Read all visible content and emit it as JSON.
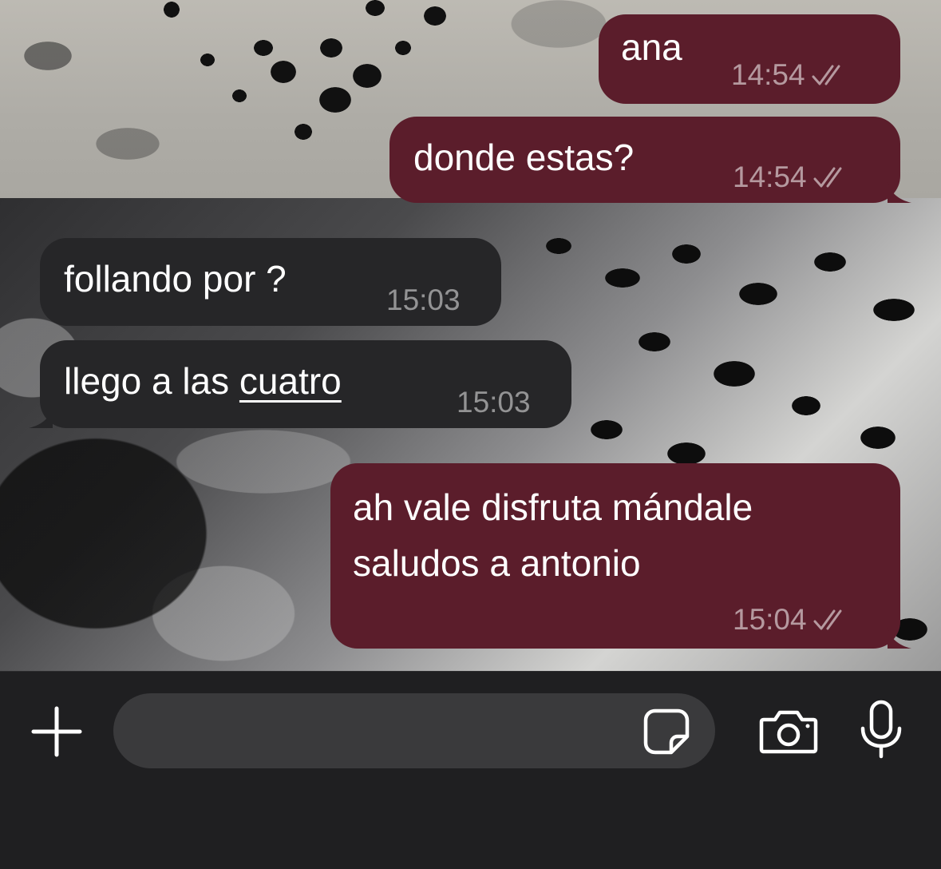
{
  "chat": {
    "messages": [
      {
        "direction": "outgoing",
        "text": "ana",
        "time": "14:54",
        "status": "read"
      },
      {
        "direction": "outgoing",
        "text": "donde estas?",
        "time": "14:54",
        "status": "read"
      },
      {
        "direction": "incoming",
        "text": "follando por ?",
        "time": "15:03"
      },
      {
        "direction": "incoming",
        "text_before_link": "llego a las ",
        "link_text": "cuatro",
        "time": "15:03"
      },
      {
        "direction": "outgoing",
        "text_line1": "ah vale disfruta mándale",
        "text_line2": "saludos a antonio",
        "time": "15:04",
        "status": "read"
      }
    ]
  },
  "input_bar": {
    "message_value": "",
    "icons": {
      "attach": "plus-icon",
      "sticker": "sticker-icon",
      "camera": "camera-icon",
      "voice": "microphone-icon"
    }
  },
  "colors": {
    "outgoing_bubble": "#5b1d2b",
    "incoming_bubble": "#262628",
    "input_bar": "#1f1f21",
    "input_field": "#3a3a3c"
  }
}
